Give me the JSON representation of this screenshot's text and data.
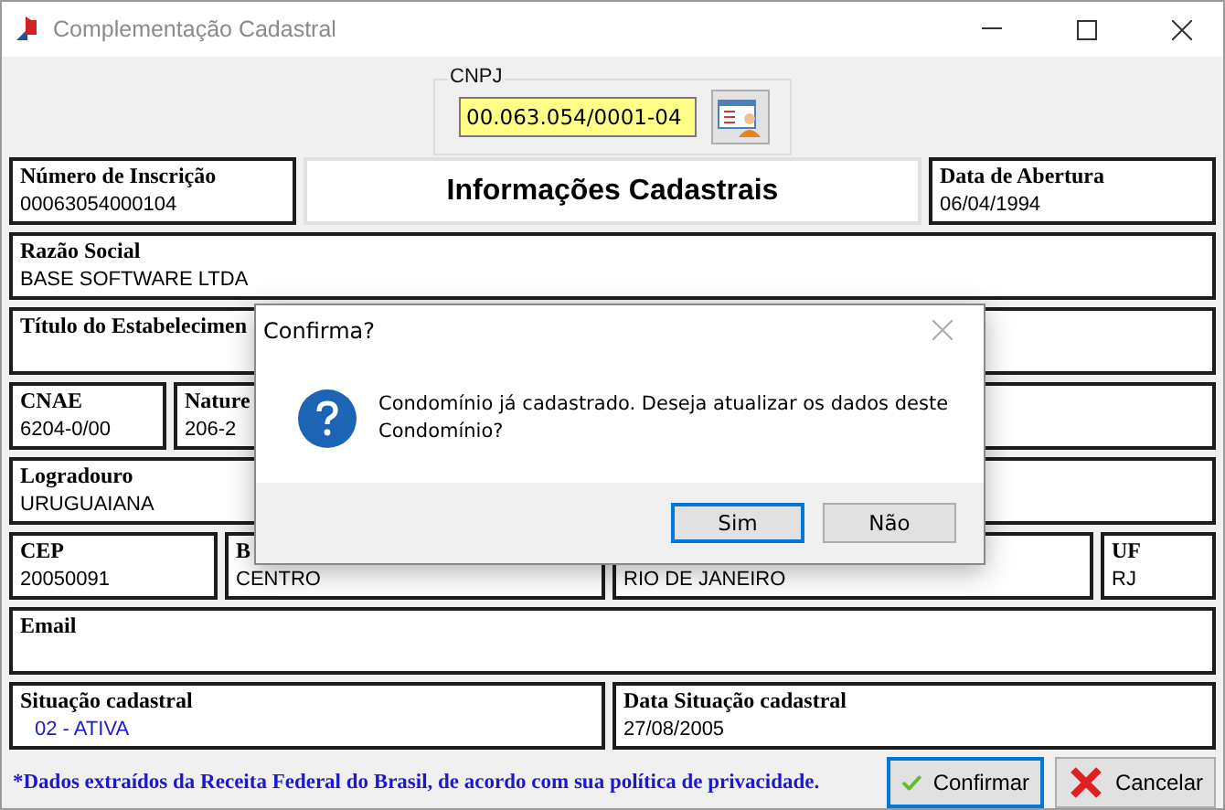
{
  "window": {
    "title": "Complementação Cadastral"
  },
  "cnpj": {
    "label": "CNPJ",
    "value": "00.063.054/0001-04"
  },
  "rows": [
    [
      {
        "kind": "field",
        "label": "Número de Inscrição",
        "value": "00063054000104"
      },
      {
        "kind": "heading",
        "label": "Informações Cadastrais"
      },
      {
        "kind": "field",
        "label": "Data de Abertura",
        "value": "06/04/1994"
      }
    ],
    [
      {
        "kind": "field",
        "label": "Razão Social",
        "value": "BASE SOFTWARE LTDA"
      }
    ],
    [
      {
        "kind": "field",
        "label": "Título do Estabelecimen"
      }
    ],
    [
      {
        "kind": "field",
        "label": "CNAE",
        "value": "6204-0/00"
      },
      {
        "kind": "field",
        "label": "Nature",
        "value": "206-2"
      }
    ],
    [
      {
        "kind": "field",
        "label": "Logradouro",
        "value": "URUGUAIANA"
      }
    ],
    [
      {
        "kind": "field",
        "label": "CEP",
        "value": "20050091"
      },
      {
        "kind": "field",
        "label": "B",
        "value": "CENTRO"
      },
      {
        "kind": "field",
        "value": "RIO DE JANEIRO"
      },
      {
        "kind": "field",
        "label": "UF",
        "value": "RJ"
      }
    ],
    [
      {
        "kind": "field",
        "label": "Email"
      }
    ],
    [
      {
        "kind": "status",
        "label": "Situação cadastral",
        "value": "02 - ATIVA"
      },
      {
        "kind": "field",
        "label": "Data Situação cadastral",
        "value": "27/08/2005"
      }
    ]
  ],
  "note": "*Dados extraídos da Receita Federal do Brasil, de acordo com sua política de privacidade.",
  "buttons": [
    {
      "kind": "confirm",
      "label": "Confirmar",
      "default": true
    },
    {
      "kind": "cancel",
      "label": "Cancelar",
      "default": false
    }
  ],
  "dialog": {
    "title": "Confirma?",
    "message": "Condomínio já cadastrado. Deseja atualizar os dados deste Condomínio?",
    "buttons": [
      {
        "label": "Sim",
        "default": true
      },
      {
        "label": "Não",
        "default": false
      }
    ]
  }
}
